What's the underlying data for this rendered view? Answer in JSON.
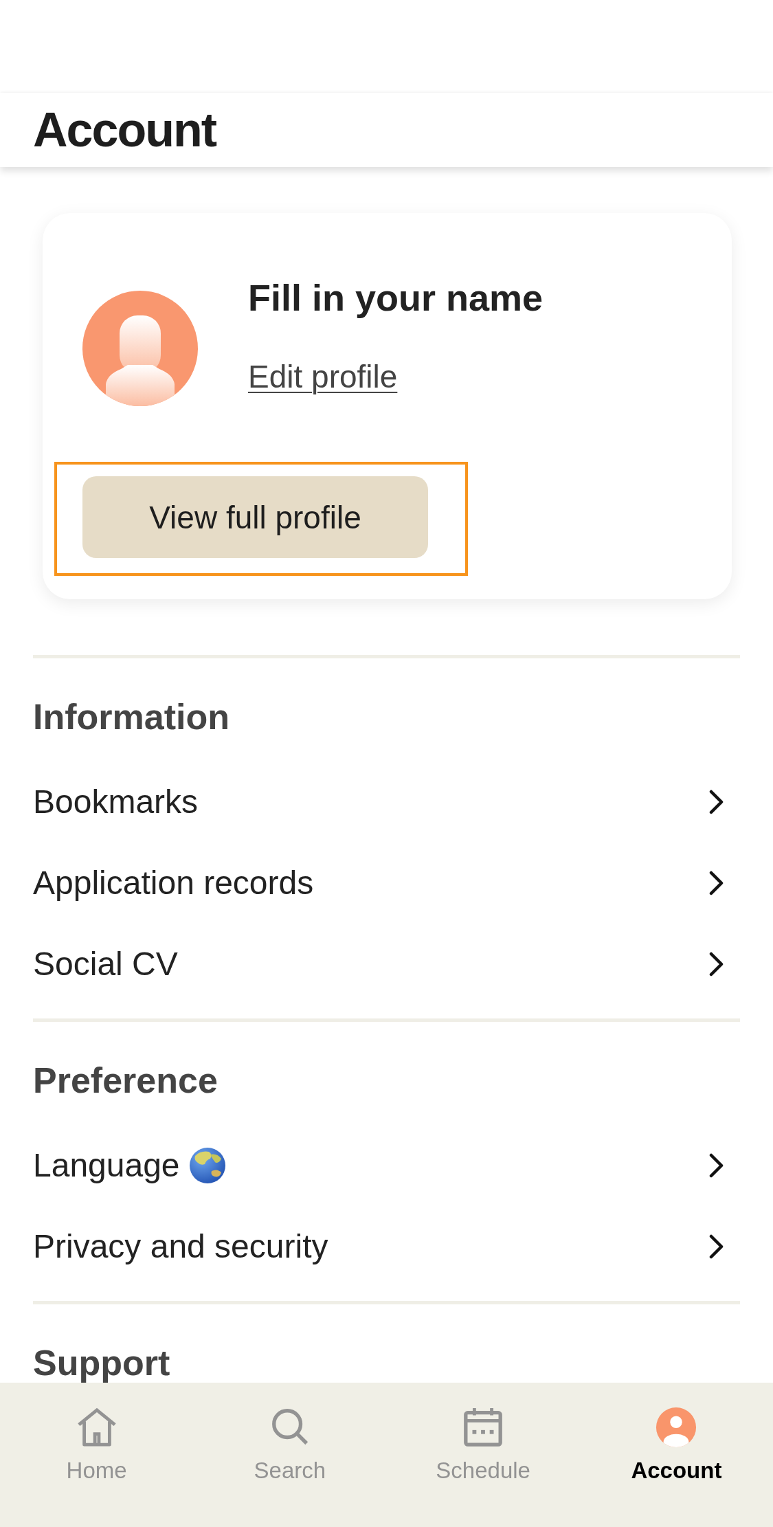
{
  "header": {
    "title": "Account"
  },
  "profile_card": {
    "name": "Fill in your name",
    "edit_link": "Edit profile",
    "button": {
      "label": "View full profile",
      "highlighted": true
    }
  },
  "sections": [
    {
      "title": "Information",
      "items": [
        {
          "label": "Bookmarks",
          "kind": "plain"
        },
        {
          "label": "Application records",
          "kind": "plain"
        },
        {
          "label": "Social CV",
          "kind": "plain"
        }
      ]
    },
    {
      "title": "Preference",
      "items": [
        {
          "label": "Language",
          "kind": "globe"
        },
        {
          "label": "Privacy and security",
          "kind": "plain"
        }
      ]
    },
    {
      "title": "Support"
    }
  ],
  "bottom_nav": [
    {
      "label": "Home",
      "kind": "home",
      "selected": false
    },
    {
      "label": "Search",
      "kind": "search",
      "selected": false
    },
    {
      "label": "Schedule",
      "kind": "calendar",
      "selected": false
    },
    {
      "label": "Account",
      "kind": "account",
      "selected": true
    }
  ]
}
